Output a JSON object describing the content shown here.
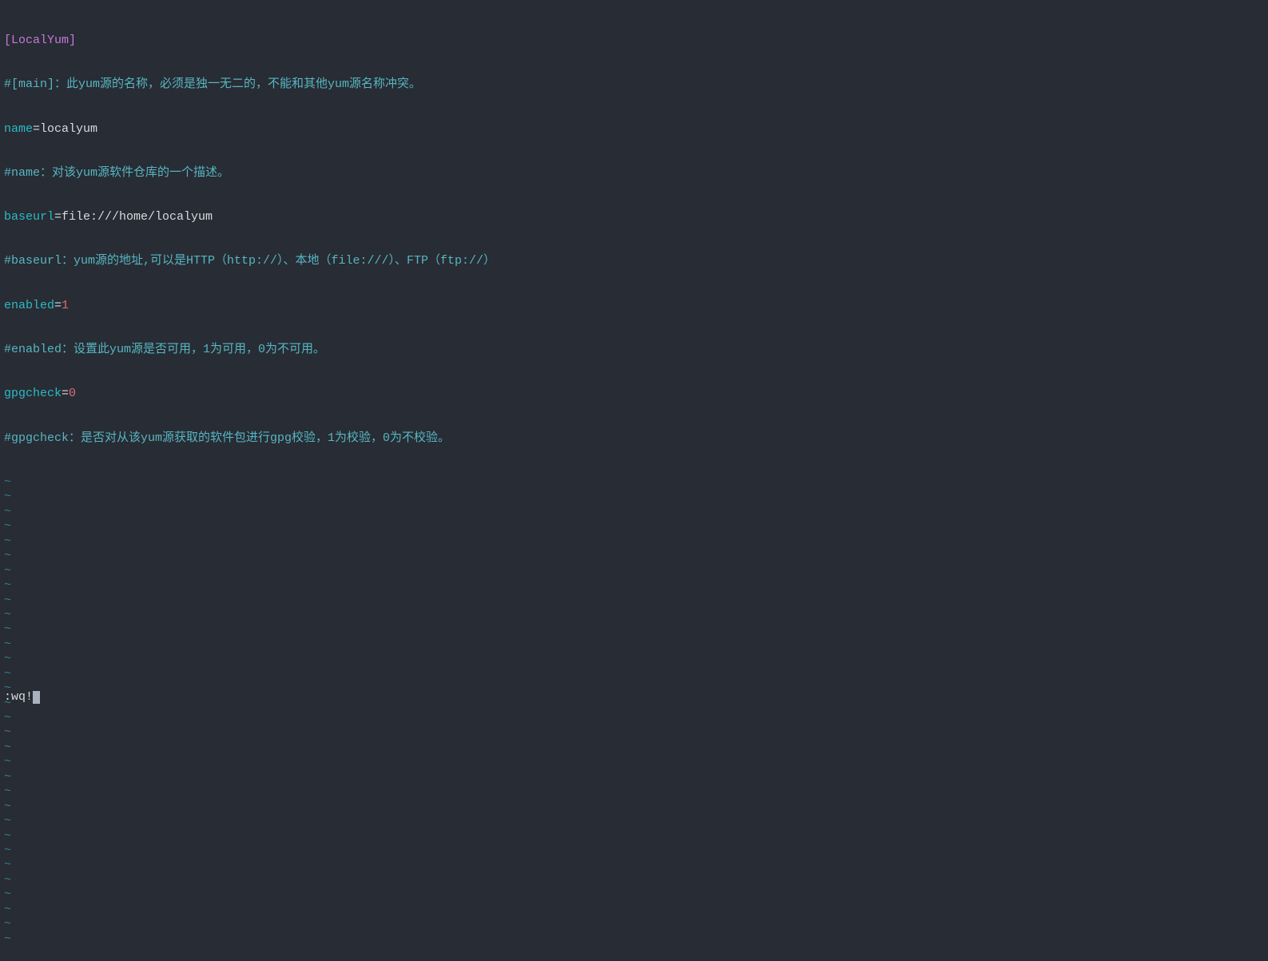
{
  "content": {
    "section_header": "[LocalYum]",
    "line2_comment": "#[main]：此yum源的名称，必须是独一无二的，不能和其他yum源名称冲突。",
    "line3_key": "name",
    "line3_eq": "=",
    "line3_val": "localyum",
    "line4_comment": "#name：对该yum源软件仓库的一个描述。",
    "line5_key": "baseurl",
    "line5_eq": "=",
    "line5_val": "file:///home/localyum",
    "line6_comment": "#baseurl：yum源的地址,可以是HTTP（http://）、本地（file:///）、FTP（ftp://）",
    "line7_key": "enabled",
    "line7_eq": "=",
    "line7_val": "1",
    "line8_comment": "#enabled：设置此yum源是否可用，1为可用，0为不可用。",
    "line9_key": "gpgcheck",
    "line9_eq": "=",
    "line9_val": "0",
    "line10_comment": "#gpgcheck：是否对从该yum源获取的软件包进行gpg校验，1为校验，0为不校验。"
  },
  "tilde_char": "~",
  "tilde_count": 32,
  "command": ":wq!"
}
